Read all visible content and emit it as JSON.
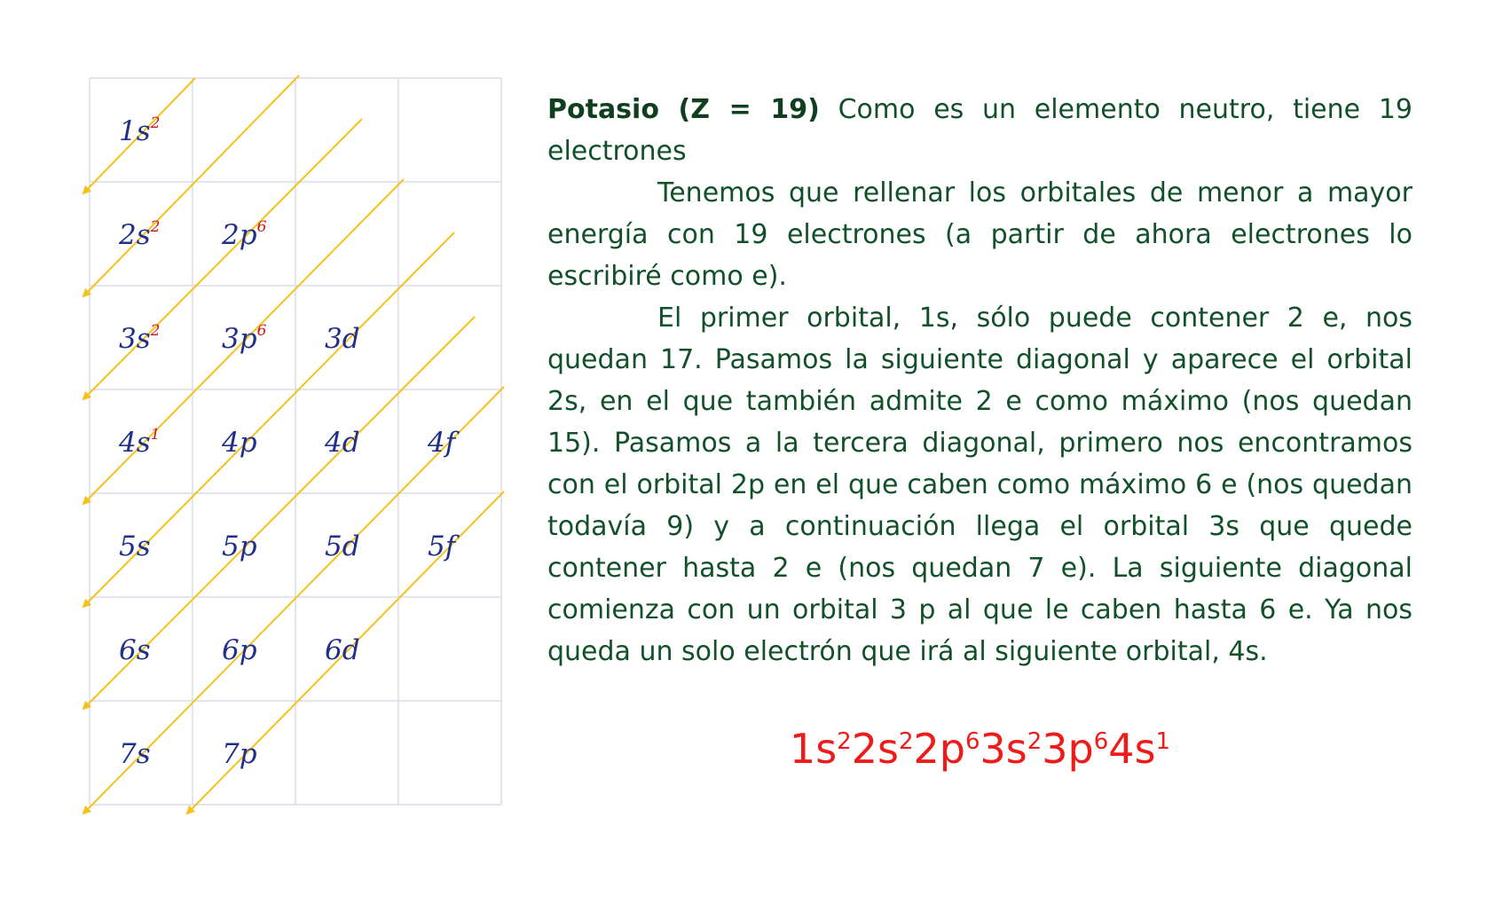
{
  "colors": {
    "grid": "#d9dde6",
    "arrow": "#f5c21b",
    "label": "#1f2f8a",
    "superscript": "#d21414",
    "text": "#12502a",
    "formula": "#ee1b1b"
  },
  "grid": {
    "rows": 7,
    "cols": 4,
    "cells": [
      {
        "row": 0,
        "col": 0,
        "main": "1s",
        "sup": "2"
      },
      {
        "row": 1,
        "col": 0,
        "main": "2s",
        "sup": "2"
      },
      {
        "row": 1,
        "col": 1,
        "main": "2p",
        "sup": "6"
      },
      {
        "row": 2,
        "col": 0,
        "main": "3s",
        "sup": "2"
      },
      {
        "row": 2,
        "col": 1,
        "main": "3p",
        "sup": "6"
      },
      {
        "row": 2,
        "col": 2,
        "main": "3d",
        "sup": ""
      },
      {
        "row": 3,
        "col": 0,
        "main": "4s",
        "sup": "1"
      },
      {
        "row": 3,
        "col": 1,
        "main": "4p",
        "sup": ""
      },
      {
        "row": 3,
        "col": 2,
        "main": "4d",
        "sup": ""
      },
      {
        "row": 3,
        "col": 3,
        "main": "4f",
        "sup": ""
      },
      {
        "row": 4,
        "col": 0,
        "main": "5s",
        "sup": ""
      },
      {
        "row": 4,
        "col": 1,
        "main": "5p",
        "sup": ""
      },
      {
        "row": 4,
        "col": 2,
        "main": "5d",
        "sup": ""
      },
      {
        "row": 4,
        "col": 3,
        "main": "5f",
        "sup": ""
      },
      {
        "row": 5,
        "col": 0,
        "main": "6s",
        "sup": ""
      },
      {
        "row": 5,
        "col": 1,
        "main": "6p",
        "sup": ""
      },
      {
        "row": 5,
        "col": 2,
        "main": "6d",
        "sup": ""
      },
      {
        "row": 6,
        "col": 0,
        "main": "7s",
        "sup": ""
      },
      {
        "row": 6,
        "col": 1,
        "main": "7p",
        "sup": ""
      }
    ],
    "diagonal_count": 8
  },
  "text": {
    "title": "Potasio (Z = 19)",
    "intro": " Como es un elemento neutro, tiene 19 electrones",
    "paragraph1": "Tenemos que rellenar los orbitales de menor a mayor energía con 19 electrones (a partir de ahora electrones lo escribiré como e).",
    "paragraph2": "El primer orbital, 1s, sólo puede contener 2 e, nos quedan 17. Pasamos la siguiente diagonal y aparece el orbital 2s, en el que también admite 2 e como máximo (nos quedan 15). Pasamos a la tercera diagonal, primero nos encontramos con el orbital 2p en el que caben como máximo 6 e (nos quedan todavía 9) y a continuación llega el orbital 3s que quede contener hasta 2 e (nos quedan 7 e). La siguiente diagonal comienza con un orbital 3 p al que le caben hasta 6 e. Ya nos queda un solo electrón que irá al siguiente orbital, 4s."
  },
  "formula": [
    {
      "base": "1s",
      "exp": "2"
    },
    {
      "base": "2s",
      "exp": "2"
    },
    {
      "base": "2p",
      "exp": "6"
    },
    {
      "base": "3s",
      "exp": "2"
    },
    {
      "base": "3p",
      "exp": "6"
    },
    {
      "base": "4s",
      "exp": "1"
    }
  ]
}
